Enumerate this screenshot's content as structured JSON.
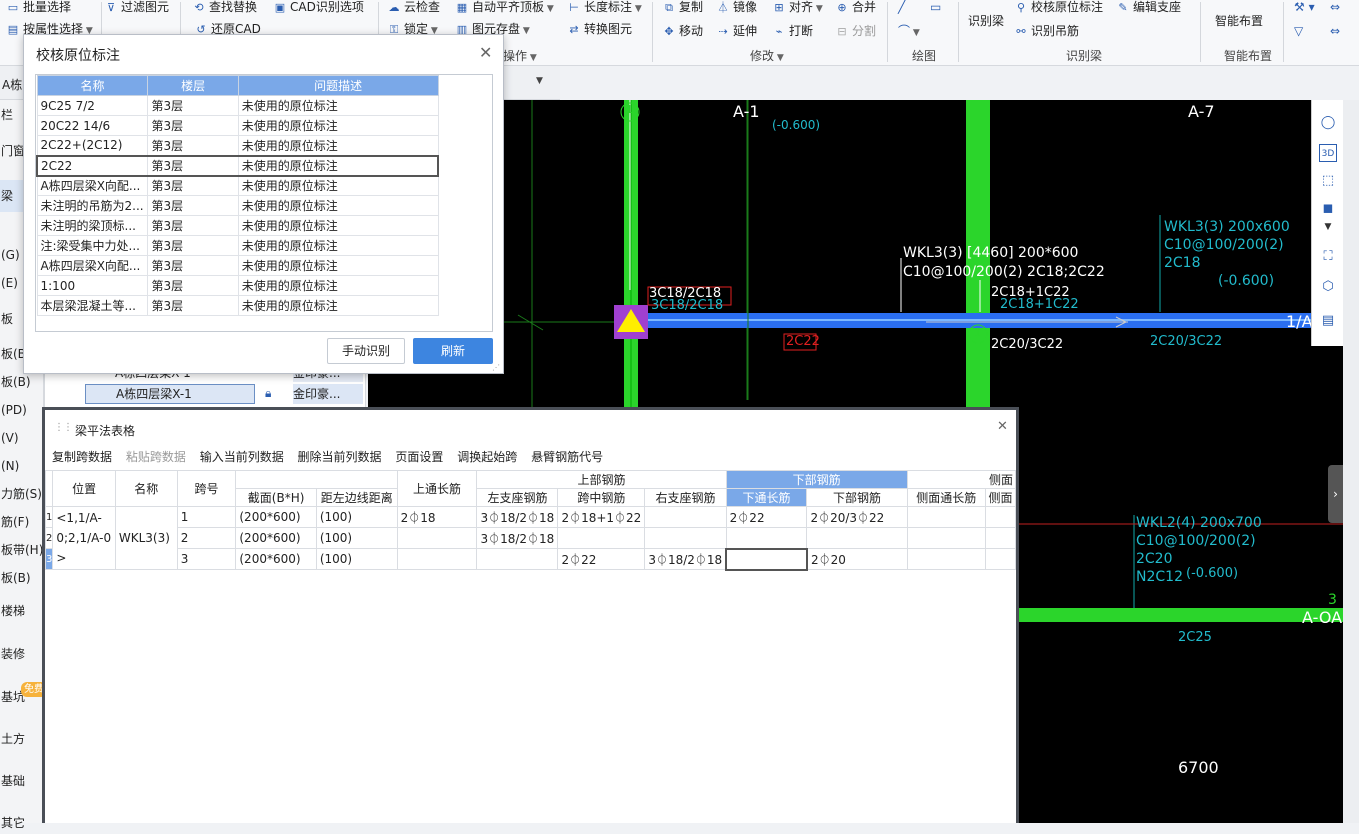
{
  "ribbon": {
    "g1": [
      "批量选择",
      "按属性选择"
    ],
    "g2": [
      "过滤图元",
      "还原CAD"
    ],
    "g3": [
      "查找替换",
      "CAD识别选项"
    ],
    "g4": [
      "云检查",
      "锁定"
    ],
    "g5": [
      "自动平齐顶板",
      "图元存盘"
    ],
    "g6": [
      "长度标注",
      "转换图元"
    ],
    "g5_label": "操作",
    "edit": [
      "复制",
      "镜像",
      "对齐",
      "合并",
      "移动",
      "延伸",
      "打断",
      "分割"
    ],
    "edit_label": "修改",
    "draw_label": "绘图",
    "recog": [
      "识别梁",
      "校核原位标注",
      "编辑支座",
      "识别吊筋"
    ],
    "recog_label": "识别梁",
    "smart": "智能布置",
    "smart_label": "智能布置"
  },
  "tabbar": {
    "left_text": "A栋"
  },
  "left_panel": [
    "栏",
    "门窗",
    "梁",
    "(G)",
    "(E)",
    "板",
    "板(B)",
    "板(B)",
    "(PD)",
    "(V)",
    "(N)",
    "力筋(S)",
    "筋(F)",
    "板带(H)",
    "板(B)",
    "楼梯",
    "装修",
    "基坑",
    "土方",
    "基础",
    "其它"
  ],
  "free_badge": "免费",
  "mid_panel": {
    "row1": "A栋四层梁X-1",
    "row1b": "金印豪...",
    "row2": "A栋四层梁X-1",
    "row2b": "金印豪..."
  },
  "dialog": {
    "title": "校核原位标注",
    "headers": [
      "名称",
      "楼层",
      "问题描述"
    ],
    "rows": [
      [
        "9C25 7/2",
        "第3层",
        "未使用的原位标注"
      ],
      [
        "20C22 14/6",
        "第3层",
        "未使用的原位标注"
      ],
      [
        "2C22+(2C12)",
        "第3层",
        "未使用的原位标注"
      ],
      [
        "2C22",
        "第3层",
        "未使用的原位标注"
      ],
      [
        "A栋四层梁X向配...",
        "第3层",
        "未使用的原位标注"
      ],
      [
        "未注明的吊筋为2...",
        "第3层",
        "未使用的原位标注"
      ],
      [
        "未注明的梁顶标...",
        "第3层",
        "未使用的原位标注"
      ],
      [
        "注:梁受集中力处...",
        "第3层",
        "未使用的原位标注"
      ],
      [
        "A栋四层梁X向配...",
        "第3层",
        "未使用的原位标注"
      ],
      [
        "1:100",
        "第3层",
        "未使用的原位标注"
      ],
      [
        "本层梁混凝土等...",
        "第3层",
        "未使用的原位标注"
      ]
    ],
    "btn_manual": "手动识别",
    "btn_refresh": "刷新"
  },
  "canvas": {
    "axis_a1": "A-1",
    "axis_a7": "A-7",
    "elev1": "(-0.600)",
    "wkl3_a": "WKL3(3) [4460] 200*600",
    "wkl3_b": "C10@100/200(2) 2C18;2C22",
    "wkl3_c": "2C18+1C22",
    "wkl3_d": "2C18+1C22",
    "left_top": "3C18/2C18",
    "left_top2": "3C18/2C18",
    "red_mid": "2C22",
    "bot1": "2C20/3C22",
    "bot2": "2C20/3C22",
    "right1": [
      "WKL3(3) 200x600",
      "C10@100/200(2)",
      "2C18",
      "(-0.600)"
    ],
    "right2": [
      "WKL2(4) 200x700",
      "C10@100/200(2)",
      "2C20",
      "N2C12",
      "(-0.600)"
    ],
    "edge_a": "1/A",
    "axis_aoa": "A-OA",
    "num3": "3",
    "c2c25": "2C25",
    "dim": "6700",
    "circle1": "1"
  },
  "beam": {
    "title": "梁平法表格",
    "toolbar": [
      "复制跨数据",
      "粘贴跨数据",
      "输入当前列数据",
      "删除当前列数据",
      "页面设置",
      "调换起始跨",
      "悬臂钢筋代号"
    ],
    "h1": {
      "pos": "位置",
      "name": "名称",
      "span": "跨号",
      "top": "上部钢筋",
      "bot": "下部钢筋",
      "side": "侧面"
    },
    "h2": {
      "sec": "截面(B*H)",
      "dist": "距左边线距离",
      "through": "上通长筋",
      "left": "左支座钢筋",
      "mid": "跨中钢筋",
      "right": "右支座钢筋",
      "botthru": "下通长筋",
      "botbar": "下部钢筋",
      "sidethru": "侧面通长筋",
      "side2": "侧面"
    },
    "rownums": [
      "1",
      "2",
      "3"
    ],
    "position": "<1,1/A-0;2,1/A-0>",
    "name": "WKL3(3)",
    "rows": [
      {
        "span": "1",
        "sec": "(200*600)",
        "dist": "(100)",
        "through": "2⏀18",
        "left": "3⏀18/2⏀18",
        "mid": "2⏀18+1⏀22",
        "right": "",
        "botthru": "2⏀22",
        "botbar": "2⏀20/3⏀22"
      },
      {
        "span": "2",
        "sec": "(200*600)",
        "dist": "(100)",
        "through": "",
        "left": "3⏀18/2⏀18",
        "mid": "",
        "right": "",
        "botthru": "",
        "botbar": ""
      },
      {
        "span": "3",
        "sec": "(200*600)",
        "dist": "(100)",
        "through": "",
        "left": "",
        "mid": "2⏀22",
        "right": "3⏀18/2⏀18",
        "botthru": "",
        "botbar": "2⏀20"
      }
    ]
  }
}
